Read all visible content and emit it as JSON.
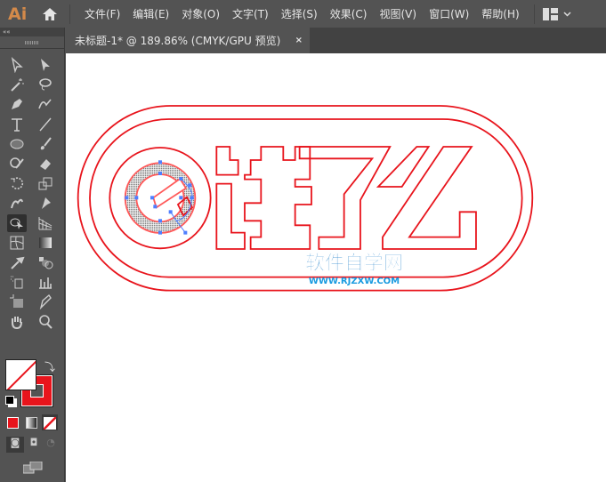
{
  "app": {
    "logo": "Ai"
  },
  "menu": [
    "文件(F)",
    "编辑(E)",
    "对象(O)",
    "文字(T)",
    "选择(S)",
    "效果(C)",
    "视图(V)",
    "窗口(W)",
    "帮助(H)"
  ],
  "document_tab": {
    "title": "未标题-1* @ 189.86% (CMYK/GPU 预览)",
    "close": "×"
  },
  "panel": {
    "collapse": "««"
  },
  "colors": {
    "stroke": "#e8141c",
    "anchor": "#4f7fff",
    "ui": "#535353"
  },
  "watermark": {
    "title": "软件自学网",
    "url": "WWW.RJZXW.COM"
  }
}
